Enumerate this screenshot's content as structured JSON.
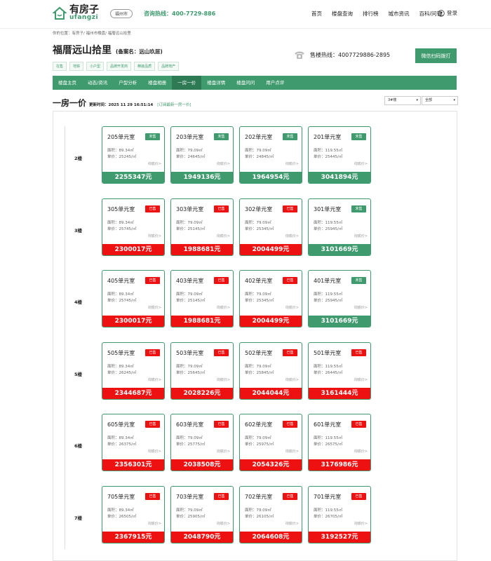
{
  "header": {
    "logo_cn": "有房子",
    "logo_en": "ufangzi",
    "city_button": "福州市",
    "hotline": "咨询热线：400-7729-886",
    "nav": [
      "首页",
      "楼盘查询",
      "排行榜",
      "城市资讯",
      "百科/问答"
    ],
    "login": "登录"
  },
  "breadcrumb": "你的位置：有房子/ 福州市楼盘/ 福厝远山拾里",
  "title": "福厝远山拾里",
  "record_name": "(备案名：远山玖居)",
  "tags": [
    "在售",
    "地铁",
    "小户型",
    "品牌开发商",
    "精装品质",
    "品牌地产"
  ],
  "sales_hotline": "售楼热线：4007729886-2895",
  "wechat_button": "微信扫码拨打",
  "tabs": [
    "楼盘主页",
    "动态/资讯",
    "户型分析",
    "楼盘相册",
    "一房一价",
    "楼盘详情",
    "楼盘问问",
    "用户点评"
  ],
  "active_tab": 4,
  "section": {
    "title": "一房一价",
    "update": "更新时间：2025 11 29 16:51:14",
    "subscribe": "[订阅最新一房一价]",
    "building_select": "3#楼",
    "filter_select": "全部"
  },
  "colors": {
    "sold": "#ee1111",
    "unsold": "#3f9a6e",
    "accent": "#3f9a6e"
  },
  "labels": {
    "area_prefix": "面积：",
    "unit_price_prefix": "单价：",
    "inquire": "询底价>"
  },
  "floors": [
    {
      "label": "2楼",
      "units": [
        {
          "room": "205单元室",
          "status": "未售",
          "area": "89.34㎡",
          "unit_price": "25245/㎡",
          "total": "2255347元"
        },
        {
          "room": "203单元室",
          "status": "未售",
          "area": "79.09㎡",
          "unit_price": "24645/㎡",
          "total": "1949136元"
        },
        {
          "room": "202单元室",
          "status": "未售",
          "area": "79.09㎡",
          "unit_price": "24845/㎡",
          "total": "1964954元"
        },
        {
          "room": "201单元室",
          "status": "未售",
          "area": "119.55㎡",
          "unit_price": "25445/㎡",
          "total": "3041894元"
        }
      ]
    },
    {
      "label": "3楼",
      "units": [
        {
          "room": "305单元室",
          "status": "已售",
          "area": "89.34㎡",
          "unit_price": "25745/㎡",
          "total": "2300017元"
        },
        {
          "room": "303单元室",
          "status": "已售",
          "area": "79.09㎡",
          "unit_price": "25145/㎡",
          "total": "1988681元"
        },
        {
          "room": "302单元室",
          "status": "已售",
          "area": "79.09㎡",
          "unit_price": "25345/㎡",
          "total": "2004499元"
        },
        {
          "room": "301单元室",
          "status": "未售",
          "area": "119.55㎡",
          "unit_price": "25945/㎡",
          "total": "3101669元"
        }
      ]
    },
    {
      "label": "4楼",
      "units": [
        {
          "room": "405单元室",
          "status": "已售",
          "area": "89.34㎡",
          "unit_price": "25745/㎡",
          "total": "2300017元"
        },
        {
          "room": "403单元室",
          "status": "已售",
          "area": "79.09㎡",
          "unit_price": "25145/㎡",
          "total": "1988681元"
        },
        {
          "room": "402单元室",
          "status": "已售",
          "area": "79.09㎡",
          "unit_price": "25345/㎡",
          "total": "2004499元"
        },
        {
          "room": "401单元室",
          "status": "未售",
          "area": "119.55㎡",
          "unit_price": "25945/㎡",
          "total": "3101669元"
        }
      ]
    },
    {
      "label": "5楼",
      "units": [
        {
          "room": "505单元室",
          "status": "已售",
          "area": "89.34㎡",
          "unit_price": "26245/㎡",
          "total": "2344687元"
        },
        {
          "room": "503单元室",
          "status": "已售",
          "area": "79.09㎡",
          "unit_price": "25645/㎡",
          "total": "2028226元"
        },
        {
          "room": "502单元室",
          "status": "已售",
          "area": "79.09㎡",
          "unit_price": "25845/㎡",
          "total": "2044044元"
        },
        {
          "room": "501单元室",
          "status": "已售",
          "area": "119.55㎡",
          "unit_price": "26445/㎡",
          "total": "3161444元"
        }
      ]
    },
    {
      "label": "6楼",
      "units": [
        {
          "room": "605单元室",
          "status": "已售",
          "area": "89.34㎡",
          "unit_price": "26375/㎡",
          "total": "2356301元"
        },
        {
          "room": "603单元室",
          "status": "已售",
          "area": "79.09㎡",
          "unit_price": "25775/㎡",
          "total": "2038508元"
        },
        {
          "room": "602单元室",
          "status": "已售",
          "area": "79.09㎡",
          "unit_price": "25975/㎡",
          "total": "2054326元"
        },
        {
          "room": "601单元室",
          "status": "已售",
          "area": "119.55㎡",
          "unit_price": "26575/㎡",
          "total": "3176986元"
        }
      ]
    },
    {
      "label": "7楼",
      "units": [
        {
          "room": "705单元室",
          "status": "已售",
          "area": "89.34㎡",
          "unit_price": "26505/㎡",
          "total": "2367915元"
        },
        {
          "room": "703单元室",
          "status": "已售",
          "area": "79.09㎡",
          "unit_price": "25905/㎡",
          "total": "2048790元"
        },
        {
          "room": "702单元室",
          "status": "已售",
          "area": "79.09㎡",
          "unit_price": "26105/㎡",
          "total": "2064608元"
        },
        {
          "room": "701单元室",
          "status": "已售",
          "area": "119.55㎡",
          "unit_price": "26705/㎡",
          "total": "3192527元"
        }
      ]
    }
  ]
}
